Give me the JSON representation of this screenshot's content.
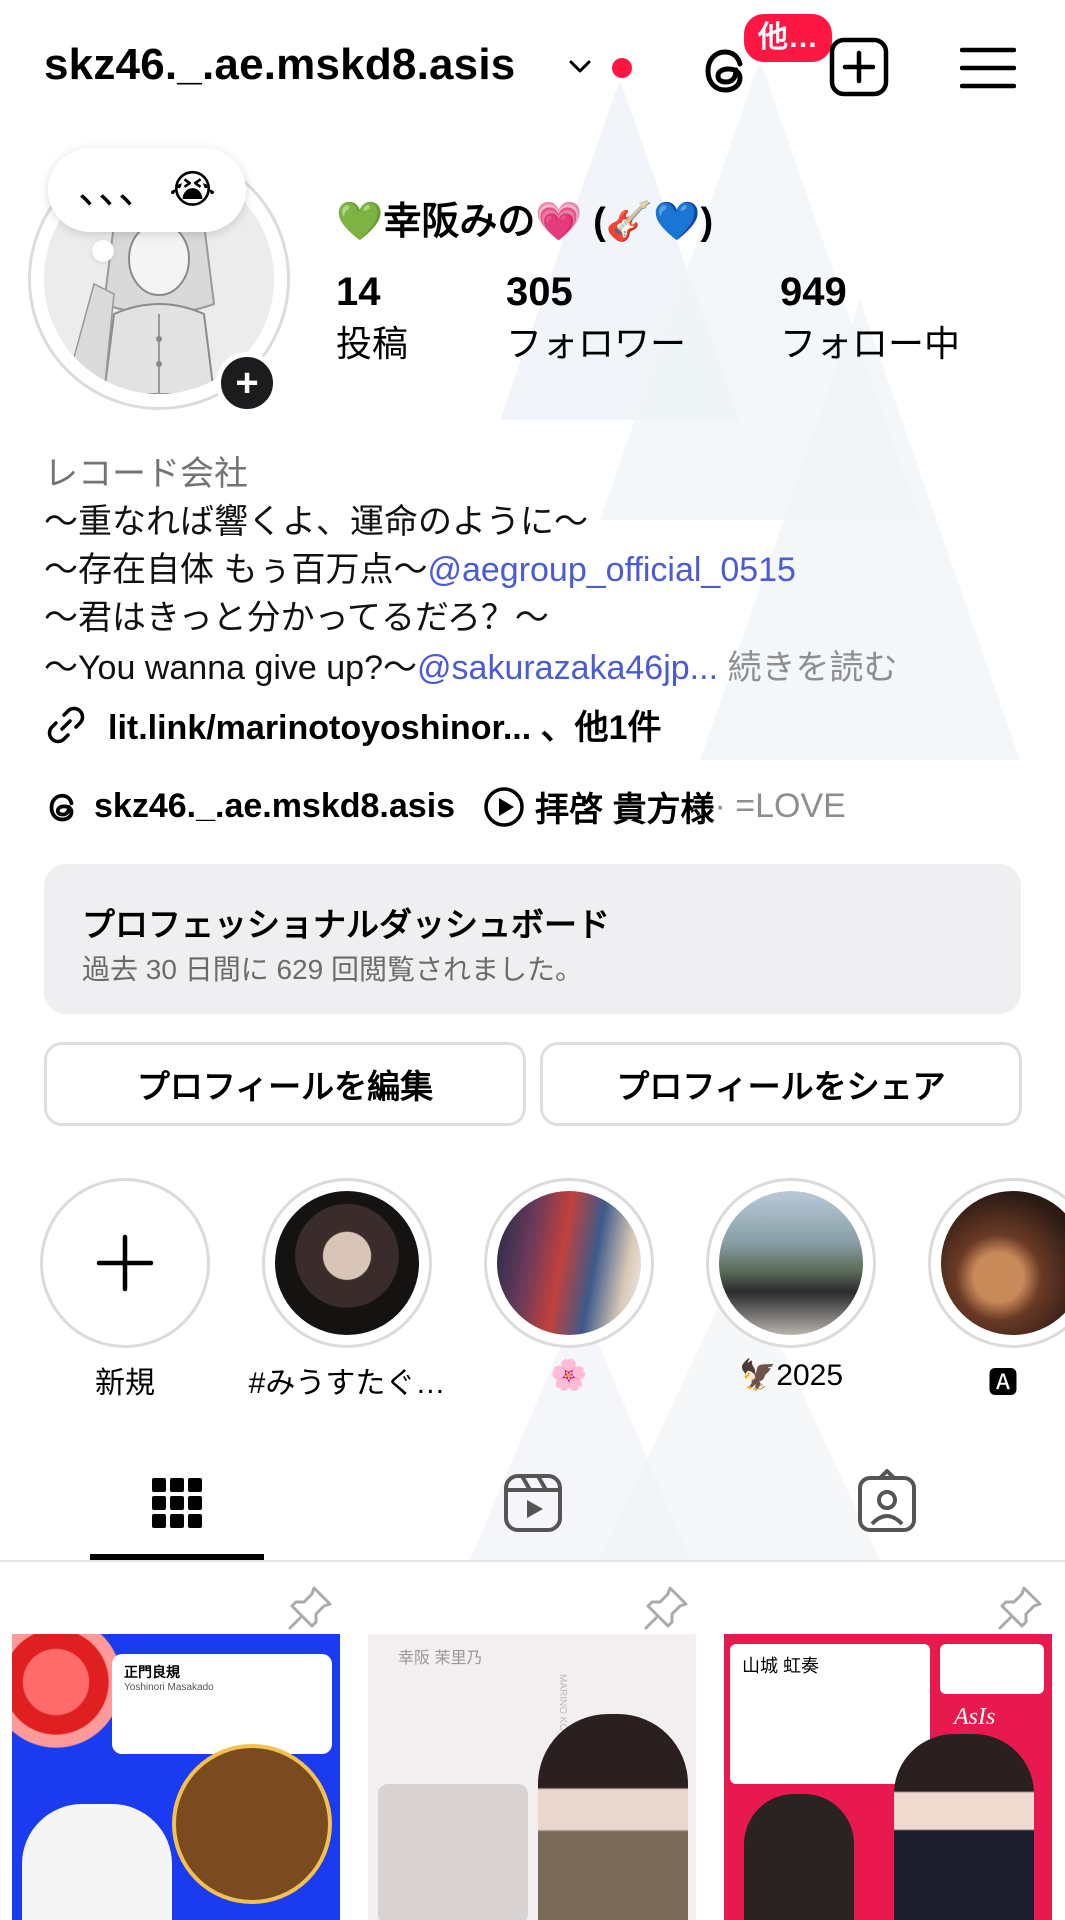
{
  "header": {
    "username": "skz46._.ae.mskd8.asis",
    "notification_badge": "他…"
  },
  "profile": {
    "note": "、、、 😭",
    "display_name": "💚幸阪みの💗 (🎸💙)",
    "stats": [
      {
        "value": "14",
        "label": "投稿"
      },
      {
        "value": "305",
        "label": "フォロワー"
      },
      {
        "value": "949",
        "label": "フォロー中"
      }
    ],
    "category": "レコード会社",
    "bio": {
      "line1": "〜重なれば響くよ、運命のように〜",
      "line2_text": "〜存在自体 もぅ百万点〜",
      "line2_mention": "@aegroup_official_0515",
      "line3": "〜君はきっと分かってるだろ？〜",
      "line4_text": "〜You wanna give up?〜",
      "line4_mention": "@sakurazaka46jp...",
      "more": "続きを読む"
    },
    "link": "lit.link/marinotoyoshinor... 、他1件",
    "threads_handle": "skz46._.ae.mskd8.asis",
    "music_title": "拝啓 貴方様",
    "music_artist": " · =LOVE"
  },
  "dashboard": {
    "title": "プロフェッショナルダッシュボード",
    "subtitle": "過去 30 日間に 629 回閲覧されました。"
  },
  "buttons": {
    "edit": "プロフィールを編集",
    "share": "プロフィールをシェア"
  },
  "highlights": [
    {
      "label": "新規"
    },
    {
      "label": "#みうすたぐ…"
    },
    {
      "label": "🌸"
    },
    {
      "label": "🦅2025"
    },
    {
      "label": "🅰"
    }
  ],
  "posts": [
    {
      "name": "正門良規",
      "detail": "Yoshinori Masakado"
    },
    {
      "name": "幸阪 茉里乃",
      "detail": "MARINO KOSAKA"
    },
    {
      "name": "山城 虹奏",
      "detail": "AsIs"
    }
  ],
  "colors": {
    "badge": "#ff1744",
    "mention": "#4a5bd4",
    "dashboard_bg": "#efeff1"
  }
}
